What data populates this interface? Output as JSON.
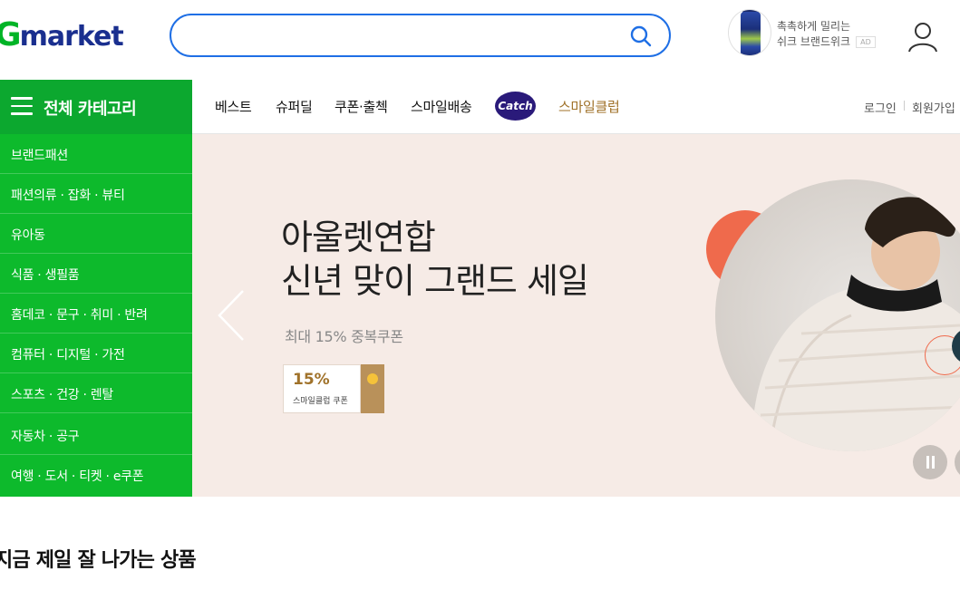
{
  "header": {
    "logo_g": "G",
    "logo_rest": "market",
    "search": {
      "value": "",
      "placeholder": ""
    },
    "ad": {
      "line1": "촉촉하게 밀리는",
      "line2": "쉬크 브랜드위크",
      "badge": "AD"
    }
  },
  "category": {
    "title": "전체 카테고리"
  },
  "nav": {
    "items": [
      "베스트",
      "슈퍼딜",
      "쿠폰·출첵",
      "스마일배송"
    ],
    "catch_label": "Catch",
    "smile_club": "스마일클럽",
    "login": "로그인",
    "signup": "회원가입"
  },
  "sidebar": {
    "items": [
      "브랜드패션",
      "패션의류 · 잡화 · 뷰티",
      "유아동",
      "식품 · 생필품",
      "홈데코 · 문구 · 취미 · 반려",
      "컴퓨터 · 디지털 · 가전",
      "스포츠 · 건강 · 렌탈",
      "자동차 · 공구",
      "여행 · 도서 · 티켓 · e쿠폰"
    ]
  },
  "banner": {
    "title_line1": "아울렛연합",
    "title_line2": "신년 맞이 그랜드 세일",
    "subtitle": "최대 15% 중복쿠폰",
    "coupon_percent": "15%",
    "coupon_label": "스마일클럽 쿠폰"
  },
  "section": {
    "title": "지금 제일 잘 나가는 상품"
  },
  "colors": {
    "brand_green": "#0ca82f",
    "sidebar_green": "#0dba2c",
    "search_blue": "#1f6fe5",
    "logo_navy": "#1a2f8f",
    "banner_bg": "#f6ebe6",
    "accent_orange": "#ef6a4c",
    "smile_gold": "#a0722a"
  },
  "icons": {
    "search": "search-icon",
    "user": "user-icon",
    "menu": "hamburger-menu-icon",
    "prev": "chevron-left-icon",
    "pause": "pause-icon"
  }
}
